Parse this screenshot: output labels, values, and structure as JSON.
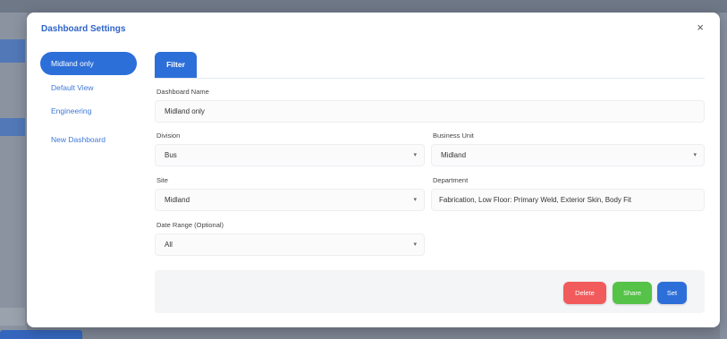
{
  "modal": {
    "title": "Dashboard Settings",
    "close_label": "×"
  },
  "nav": {
    "items": [
      {
        "label": "Midland only",
        "active": true
      },
      {
        "label": "Default View",
        "active": false
      },
      {
        "label": "Engineering",
        "active": false
      },
      {
        "label": "New Dashboard",
        "active": false
      }
    ]
  },
  "tabs": [
    {
      "label": "Filter",
      "active": true
    }
  ],
  "form": {
    "dashboard_name": {
      "label": "Dashboard Name",
      "value": "Midland only"
    },
    "division": {
      "label": "Division",
      "value": "Bus"
    },
    "business_unit": {
      "label": "Business Unit",
      "value": "Midland"
    },
    "site": {
      "label": "Site",
      "value": "Midland"
    },
    "department": {
      "label": "Department",
      "value": "Fabrication, Low Floor: Primary Weld, Exterior Skin, Body Fit"
    },
    "date_range": {
      "label": "Date Range (Optional)",
      "value": "All"
    }
  },
  "footer": {
    "delete_label": "Delete",
    "share_label": "Share",
    "set_label": "Set"
  },
  "colors": {
    "accent": "#2d6fd8",
    "danger": "#f25b5b",
    "success": "#55c248"
  }
}
